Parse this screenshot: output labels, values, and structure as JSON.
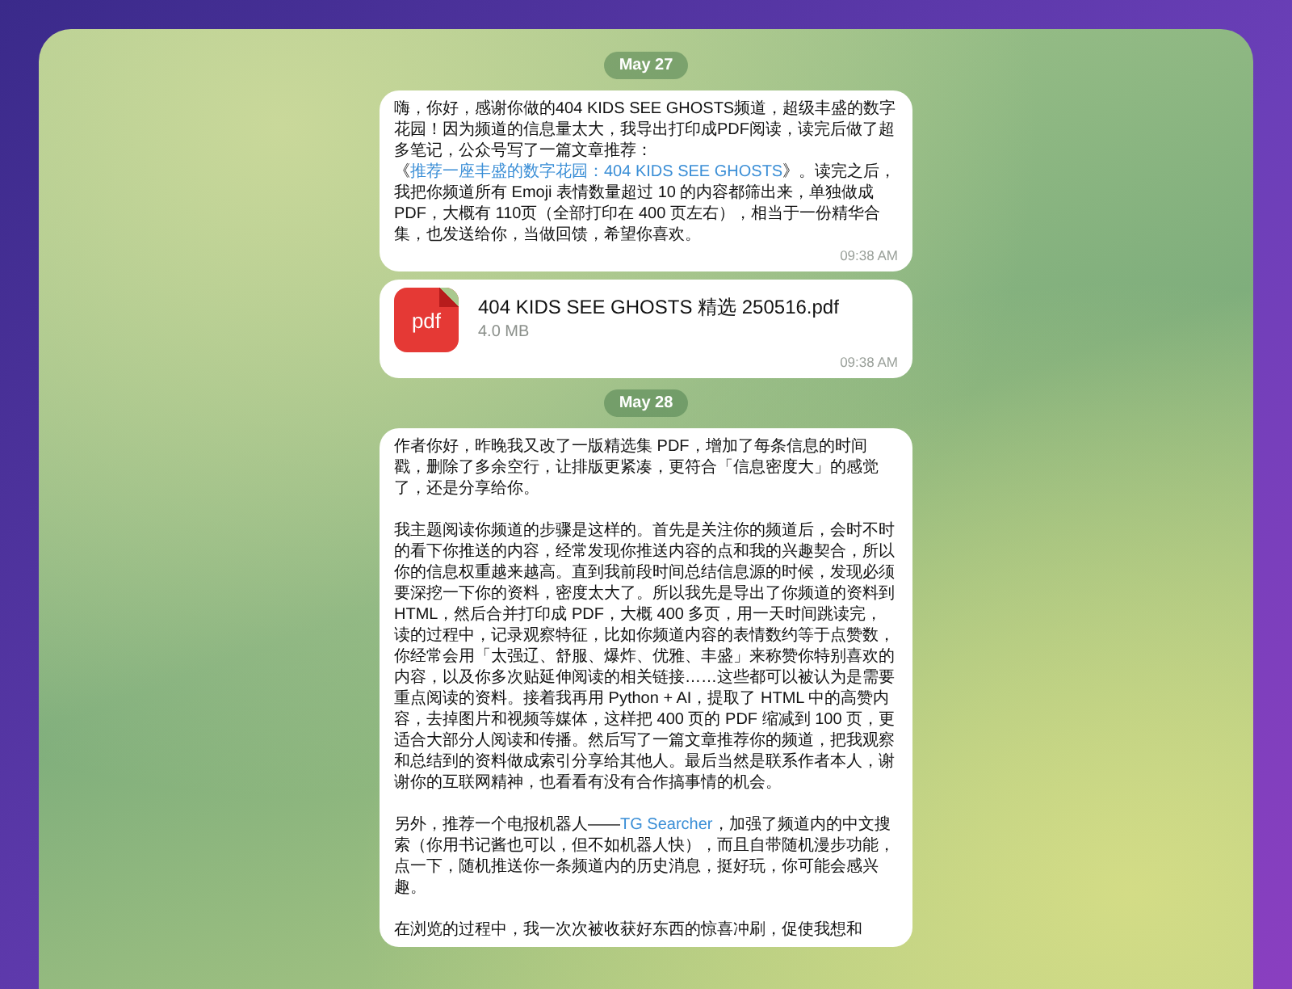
{
  "messages": [
    {
      "kind": "date",
      "text": "May 27"
    },
    {
      "kind": "text",
      "time": "09:38 AM",
      "paragraphs": [
        [
          {
            "kind": "plain",
            "text": "嗨，你好，感谢你做的404 KIDS SEE GHOSTS频道，超级丰盛的数字花园！因为频道的信息量太大，我导出打印成PDF阅读，读完后做了超多笔记，公众号写了一篇文章推荐：《"
          },
          {
            "kind": "link",
            "text": "推荐一座丰盛的数字花园：404 KIDS SEE GHOSTS"
          },
          {
            "kind": "plain",
            "text": "》。读完之后，我把你频道所有 Emoji 表情数量超过 10 的内容都筛出来，单独做成 PDF，大概有 110页（全部打印在 400 页左右），相当于一份精华合集，也发送给你，当做回馈，希望你喜欢。"
          }
        ]
      ]
    },
    {
      "kind": "file",
      "time": "09:38 AM",
      "icon_label": "pdf",
      "name": "404 KIDS SEE GHOSTS 精选 250516.pdf",
      "size": "4.0 MB"
    },
    {
      "kind": "date",
      "text": "May 28"
    },
    {
      "kind": "text",
      "paragraphs": [
        [
          {
            "kind": "plain",
            "text": "作者你好，昨晚我又改了一版精选集 PDF，增加了每条信息的时间戳，删除了多余空行，让排版更紧凑，更符合「信息密度大」的感觉了，还是分享给你。"
          }
        ],
        [
          {
            "kind": "plain",
            "text": "我主题阅读你频道的步骤是这样的。首先是关注你的频道后，会时不时的看下你推送的内容，经常发现你推送内容的点和我的兴趣契合，所以你的信息权重越来越高。直到我前段时间总结信息源的时候，发现必须要深挖一下你的资料，密度太大了。所以我先是导出了你频道的资料到 HTML，然后合并打印成 PDF，大概 400 多页，用一天时间跳读完，读的过程中，记录观察特征，比如你频道内容的表情数约等于点赞数，你经常会用「太强辽、舒服、爆炸、优雅、丰盛」来称赞你特别喜欢的内容，以及你多次贴延伸阅读的相关链接……这些都可以被认为是需要重点阅读的资料。接着我再用 Python + AI，提取了 HTML 中的高赞内容，去掉图片和视频等媒体，这样把 400 页的 PDF 缩减到 100 页，更适合大部分人阅读和传播。然后写了一篇文章推荐你的频道，把我观察和总结到的资料做成索引分享给其他人。最后当然是联系作者本人，谢谢你的互联网精神，也看看有没有合作搞事情的机会。"
          }
        ],
        [
          {
            "kind": "plain",
            "text": "另外，推荐一个电报机器人——"
          },
          {
            "kind": "link",
            "text": "TG Searcher"
          },
          {
            "kind": "plain",
            "text": "，加强了频道内的中文搜索（你用书记酱也可以，但不如机器人快），而且自带随机漫步功能，点一下，随机推送你一条频道内的历史消息，挺好玩，你可能会感兴趣。"
          }
        ],
        [
          {
            "kind": "plain",
            "text": "在浏览的过程中，我一次次被收获好东西的惊喜冲刷，促使我想和"
          }
        ]
      ]
    }
  ]
}
